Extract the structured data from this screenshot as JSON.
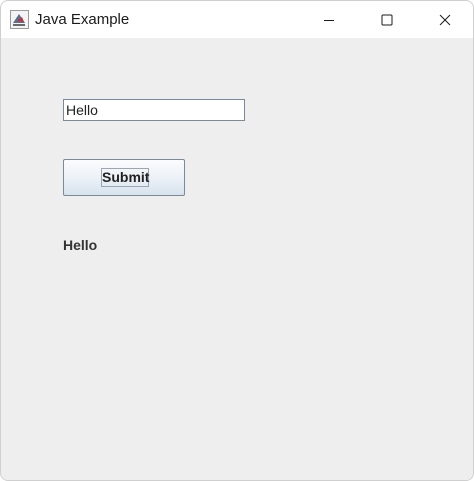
{
  "window": {
    "title": "Java Example",
    "app_icon": "java-cup-icon",
    "controls": {
      "minimize_icon": "minimize-icon",
      "maximize_icon": "maximize-icon",
      "close_icon": "close-icon"
    }
  },
  "form": {
    "text_field_value": "Hello",
    "submit_label": "Submit",
    "output_text": "Hello"
  },
  "colors": {
    "titlebar": "#ffffff",
    "content_background": "#eeeeee"
  }
}
